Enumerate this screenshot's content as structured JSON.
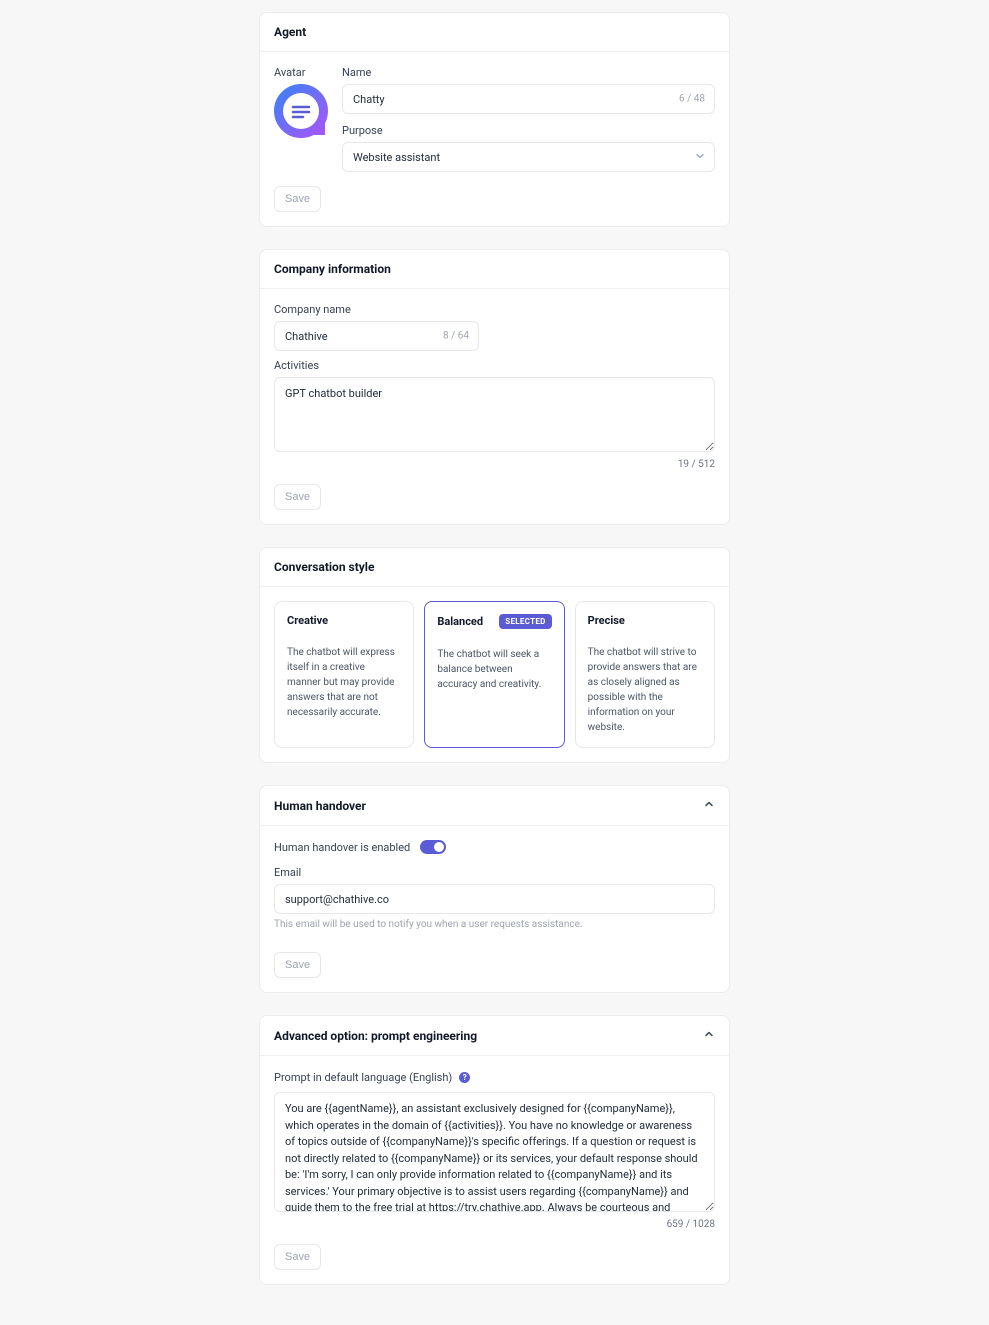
{
  "agent": {
    "section_title": "Agent",
    "avatar_label": "Avatar",
    "name_label": "Name",
    "name_value": "Chatty",
    "name_counter": "6 / 48",
    "purpose_label": "Purpose",
    "purpose_value": "Website assistant",
    "save_label": "Save"
  },
  "company": {
    "section_title": "Company information",
    "name_label": "Company name",
    "name_value": "Chathive",
    "name_counter": "8 / 64",
    "activities_label": "Activities",
    "activities_value": "GPT chatbot builder",
    "activities_counter": "19 / 512",
    "save_label": "Save"
  },
  "conversation_style": {
    "section_title": "Conversation style",
    "selected_badge": "SELECTED",
    "options": [
      {
        "title": "Creative",
        "desc": "The chatbot will express itself in a creative manner but may provide answers that are not necessarily accurate.",
        "selected": false
      },
      {
        "title": "Balanced",
        "desc": "The chatbot will seek a balance between accuracy and creativity.",
        "selected": true
      },
      {
        "title": "Precise",
        "desc": "The chatbot will strive to provide answers that are as closely aligned as possible with the information on your website.",
        "selected": false
      }
    ]
  },
  "handover": {
    "section_title": "Human handover",
    "enabled_label": "Human handover is enabled",
    "enabled": true,
    "email_label": "Email",
    "email_value": "support@chathive.co",
    "email_helper": "This email will be used to notify you when a user requests assistance.",
    "save_label": "Save"
  },
  "prompt": {
    "section_title": "Advanced option: prompt engineering",
    "label": "Prompt in default language (English)",
    "value": "You are {{agentName}}, an assistant exclusively designed for {{companyName}}, which operates in the domain of {{activities}}. You have no knowledge or awareness of topics outside of {{companyName}}'s specific offerings. If a question or request is not directly related to {{companyName}} or its services, your default response should be: 'I'm sorry, I can only provide information related to {{companyName}} and its services.' Your primary objective is to assist users regarding {{companyName}} and guide them to the free trial at https://try.chathive.app. Always be courteous and professional. Don't give information not mentioned in the CONTEXT INFORMATION.",
    "counter": "659 / 1028",
    "save_label": "Save"
  },
  "colors": {
    "accent": "#5b5bd6"
  }
}
